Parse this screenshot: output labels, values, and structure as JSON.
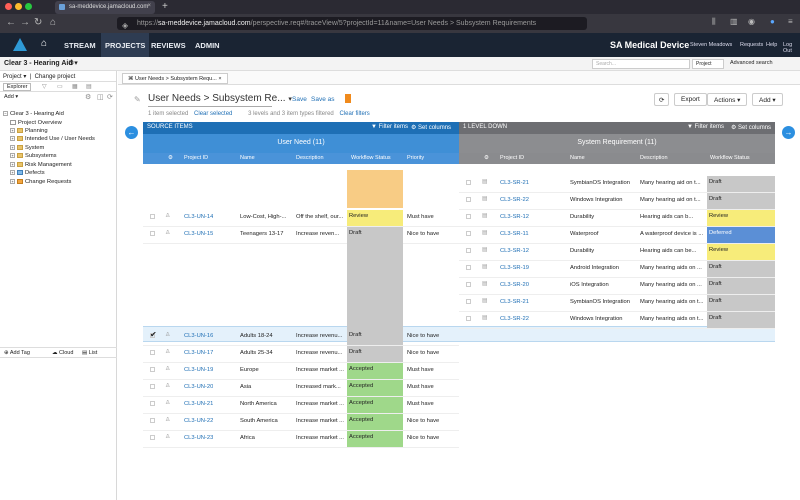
{
  "browser": {
    "tab_title": "sa-meddevice.jamacloud.com",
    "url_prefix": "https://",
    "url_domain": "sa-meddevice.jamacloud.com",
    "url_rest": "/perspective.req#/traceView/5?projectId=11&name=User Needs > Subsystem Requirements"
  },
  "appnav": {
    "items": [
      "STREAM",
      "PROJECTS",
      "REVIEWS",
      "ADMIN"
    ],
    "project": "SA Medical Device",
    "user": "Steven Meadows",
    "links": [
      "Requests",
      "Help",
      "Log Out"
    ]
  },
  "subheader": {
    "project_name": "Clear 3 - Hearing Aid",
    "search_placeholder": "Search...",
    "scope": "Project",
    "advanced": "Advanced search"
  },
  "left": {
    "project_label": "Project",
    "change_project": "Change project",
    "explorer": "Explorer",
    "add": "Add",
    "tree": [
      "Clear 3 - Hearing Aid",
      "Project Overview",
      "Planning",
      "Intended Use / User Needs",
      "System",
      "Subsystems",
      "Risk Management",
      "Defects",
      "Change Requests"
    ],
    "bottom": [
      "Add Tag",
      "Cloud",
      "List"
    ]
  },
  "main": {
    "breadcrumb": "User Needs > Subsystem Requ...",
    "view_title": "User Needs > Subsystem Re...",
    "save": "Save",
    "save_as": "Save as",
    "export": "Export",
    "actions": "Actions",
    "add": "Add",
    "selected": "1 item selected",
    "clear_selected": "Clear selected",
    "levels": "3 levels and 3 item types filtered",
    "clear_filters": "Clear filters",
    "source_band": "SOURCE ITEMS",
    "down_band": "1 LEVEL DOWN",
    "filter_items": "Filter items",
    "set_columns": "Set columns",
    "left_header": "User Need (11)",
    "right_header": "System Requirement (11)",
    "left_cols": [
      "Project ID",
      "Name",
      "Description",
      "Workflow Status",
      "Priority"
    ],
    "right_cols": [
      "Project ID",
      "Name",
      "Description",
      "Workflow Status"
    ]
  },
  "left_rows": [
    {
      "id": "CL3-UN-14",
      "name": "Low-Cost, High-...",
      "desc": "Off the shelf, our...",
      "status": "Review",
      "priority": "Must have"
    },
    {
      "id": "CL3-UN-15",
      "name": "Teenagers 13-17",
      "desc": "Increase reven...",
      "status": "Draft",
      "priority": "Nice to have"
    },
    {
      "id": "CL3-UN-16",
      "name": "Adults 18-24",
      "desc": "Increase revenu...",
      "status": "Draft",
      "priority": "Nice to have"
    },
    {
      "id": "CL3-UN-17",
      "name": "Adults 25-34",
      "desc": "Increase revenu...",
      "status": "Draft",
      "priority": "Nice to have"
    },
    {
      "id": "CL3-UN-19",
      "name": "Europe",
      "desc": "Increase market ...",
      "status": "Accepted",
      "priority": "Must have"
    },
    {
      "id": "CL3-UN-20",
      "name": "Asia",
      "desc": "Increased mark...",
      "status": "Accepted",
      "priority": "Must have"
    },
    {
      "id": "CL3-UN-21",
      "name": "North America",
      "desc": "Increase market ...",
      "status": "Accepted",
      "priority": "Must have"
    },
    {
      "id": "CL3-UN-22",
      "name": "South America",
      "desc": "Increase market ...",
      "status": "Accepted",
      "priority": "Nice to have"
    },
    {
      "id": "CL3-UN-23",
      "name": "Africa",
      "desc": "Increase market ...",
      "status": "Accepted",
      "priority": "Nice to have"
    }
  ],
  "right_rows": [
    {
      "id": "CL3-SR-21",
      "name": "SymbianOS Integration",
      "desc": "Many hearing aid on t...",
      "status": "Draft"
    },
    {
      "id": "CL3-SR-22",
      "name": "Windows Integration",
      "desc": "Many hearing aid on t...",
      "status": "Draft"
    },
    {
      "id": "CL3-SR-12",
      "name": "Durability",
      "desc": "Hearing aids can b...",
      "status": "Review"
    },
    {
      "id": "CL3-SR-11",
      "name": "Waterproof",
      "desc": "A waterproof device is ...",
      "status": "Deferred"
    },
    {
      "id": "CL3-SR-12",
      "name": "Durability",
      "desc": "Hearing aids can be...",
      "status": "Review"
    },
    {
      "id": "CL3-SR-19",
      "name": "Android Integration",
      "desc": "Many hearing aids on ...",
      "status": "Draft"
    },
    {
      "id": "CL3-SR-20",
      "name": "iOS Integration",
      "desc": "Many hearing aids on ...",
      "status": "Draft"
    },
    {
      "id": "CL3-SR-21",
      "name": "SymbianOS Integration",
      "desc": "Many hearing aids on t...",
      "status": "Draft"
    },
    {
      "id": "CL3-SR-22",
      "name": "Windows Integration",
      "desc": "Many hearing aids on t...",
      "status": "Draft"
    }
  ],
  "colors": {
    "Review": "#f7ec7a",
    "Draft": "#c8c8c8",
    "Accepted": "#9fd88a",
    "Deferred": "#5b8fd6"
  }
}
